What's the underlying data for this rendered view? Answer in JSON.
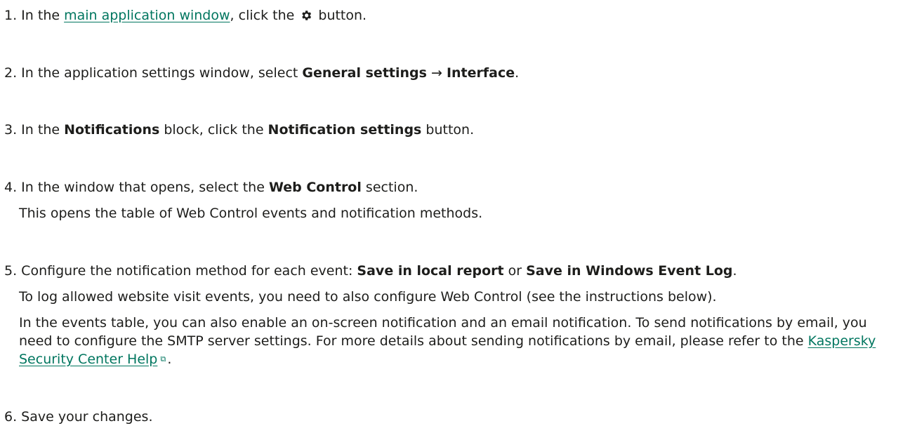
{
  "steps": [
    {
      "num": "1.",
      "pre": " In the ",
      "link": "main application window",
      "mid": ", click the ",
      "icon": "gear-icon",
      "post": " button."
    },
    {
      "num": "2.",
      "pre": " In the application settings window, select ",
      "b1": "General settings",
      "arrow": " → ",
      "b2": "Interface",
      "post": "."
    },
    {
      "num": "3.",
      "pre": " In the ",
      "b1": "Notifications",
      "mid": " block, click the ",
      "b2": "Notification settings",
      "post": " button."
    },
    {
      "num": "4.",
      "pre": " In the window that opens, select the ",
      "b1": "Web Control",
      "post": " section.",
      "note": "This opens the table of Web Control events and notification methods."
    },
    {
      "num": "5.",
      "pre": " Configure the notification method for each event: ",
      "b1": "Save in local report",
      "mid": " or ",
      "b2": "Save in Windows Event Log",
      "post": ".",
      "note1": "To log allowed website visit events, you need to also configure Web Control (see the instructions below).",
      "note2_pre": "In the events table, you can also enable an on-screen notification and an email notification. To send notifications by email, you need to configure the SMTP server settings. For more details about sending notifications by email, please refer to the ",
      "note2_link": "Kaspersky Security Center Help",
      "note2_post": "."
    },
    {
      "num": "6.",
      "text": " Save your changes."
    }
  ],
  "colors": {
    "link": "#00765f",
    "text": "#1d1d1b"
  }
}
